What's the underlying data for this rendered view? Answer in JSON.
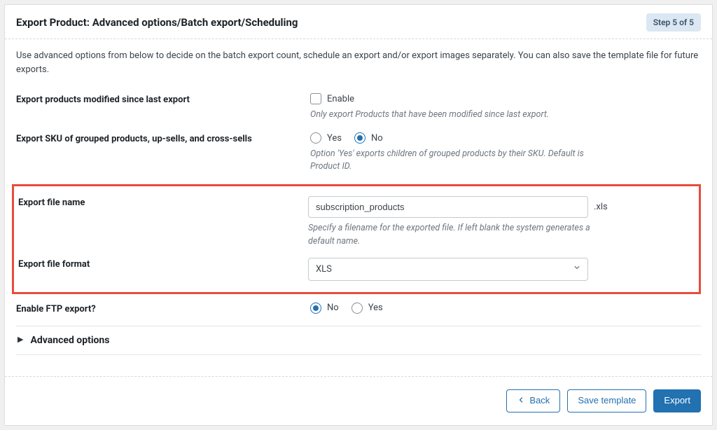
{
  "header": {
    "title": "Export Product: Advanced options/Batch export/Scheduling",
    "step_badge": "Step 5 of 5"
  },
  "intro": "Use advanced options from below to decide on the batch export count, schedule an export and/or export images separately. You can also save the template file for future exports.",
  "fields": {
    "modified_since": {
      "label": "Export products modified since last export",
      "enable_label": "Enable",
      "help": "Only export Products that have been modified since last export."
    },
    "sku_grouped": {
      "label": "Export SKU of grouped products, up-sells, and cross-sells",
      "opt_yes": "Yes",
      "opt_no": "No",
      "help": "Option 'Yes' exports children of grouped products by their SKU. Default is Product ID."
    },
    "file_name": {
      "label": "Export file name",
      "value": "subscription_products",
      "ext": ".xls",
      "help": "Specify a filename for the exported file. If left blank the system generates a default name."
    },
    "file_format": {
      "label": "Export file format",
      "value": "XLS"
    },
    "ftp": {
      "label": "Enable FTP export?",
      "opt_no": "No",
      "opt_yes": "Yes"
    }
  },
  "advanced_section": "Advanced options",
  "footer": {
    "back": "Back",
    "save": "Save template",
    "export": "Export"
  }
}
